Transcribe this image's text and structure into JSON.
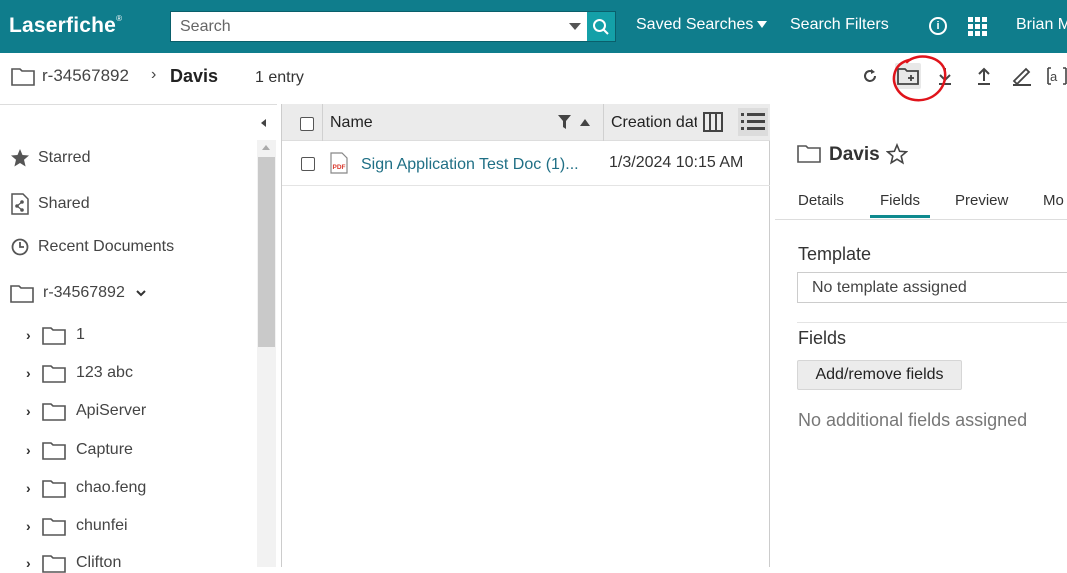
{
  "app": {
    "logo": "Laserfiche",
    "logo_mark": "®"
  },
  "search": {
    "placeholder": "Search"
  },
  "topnav": {
    "saved_searches": "Saved Searches",
    "search_filters": "Search Filters",
    "info_icon": "info-icon",
    "apps_icon": "apps-grid-icon",
    "user": "Brian M"
  },
  "breadcrumb": {
    "repository": "r-34567892",
    "separator": "›",
    "current": "Davis",
    "entry_count": "1 entry"
  },
  "toolbar": {
    "icons": [
      "refresh-icon",
      "new-folder-icon",
      "download-icon",
      "upload-icon",
      "sign-icon",
      "ocr-icon"
    ]
  },
  "sidebar": {
    "items": [
      {
        "label": "Starred",
        "icon": "star-icon"
      },
      {
        "label": "Shared",
        "icon": "shared-icon"
      },
      {
        "label": "Recent Documents",
        "icon": "clock-icon"
      },
      {
        "label": "r-34567892",
        "icon": "folder-icon"
      }
    ],
    "tree": [
      {
        "label": "1"
      },
      {
        "label": "123 abc"
      },
      {
        "label": "ApiServer"
      },
      {
        "label": "Capture"
      },
      {
        "label": "chao.feng"
      },
      {
        "label": "chunfei"
      },
      {
        "label": "Clifton"
      }
    ]
  },
  "grid": {
    "columns": {
      "name": "Name",
      "created": "Creation date"
    },
    "rows": [
      {
        "name": "Sign Application Test Doc (1)...",
        "created": "1/3/2024 10:15 AM",
        "icon": "pdf-icon"
      }
    ]
  },
  "details": {
    "title": "Davis",
    "tabs": [
      "Details",
      "Fields",
      "Preview",
      "Mo"
    ],
    "active_tab": "Fields",
    "template_heading": "Template",
    "template_value": "No template assigned",
    "fields_heading": "Fields",
    "add_remove_label": "Add/remove fields",
    "no_fields_text": "No additional fields assigned"
  },
  "colors": {
    "brand": "#0f7d8c",
    "link": "#1f6f85",
    "annotation": "#e0141b"
  }
}
